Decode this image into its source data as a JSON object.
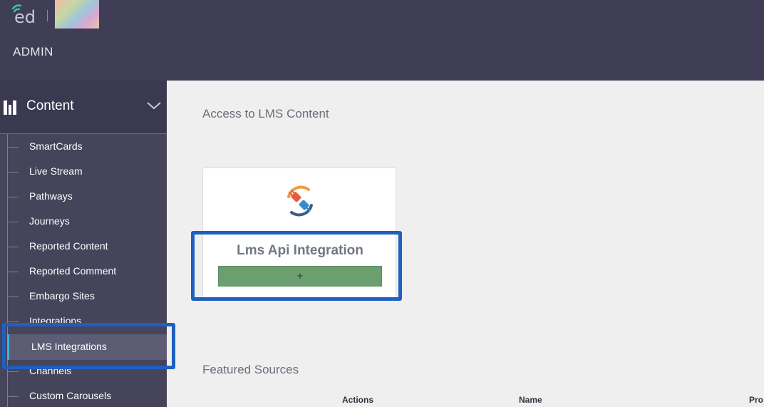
{
  "header": {
    "logo_icon": "ed-logo",
    "admin_label": "ADMIN"
  },
  "sidebar": {
    "section": {
      "title": "Content",
      "icon": "library-icon",
      "chevron": "chevron-down-icon"
    },
    "items": [
      {
        "label": "SmartCards"
      },
      {
        "label": "Live Stream"
      },
      {
        "label": "Pathways"
      },
      {
        "label": "Journeys"
      },
      {
        "label": "Reported Content"
      },
      {
        "label": "Reported Comment"
      },
      {
        "label": "Embargo Sites"
      },
      {
        "label": "Integrations"
      },
      {
        "label": "LMS Integrations",
        "active": true
      },
      {
        "label": "Channels"
      },
      {
        "label": "Custom Carousels"
      }
    ]
  },
  "main": {
    "title": "Access to LMS Content",
    "card": {
      "title": "Lms Api Integration",
      "button_label": "+",
      "icon": "plug-icon"
    },
    "featured_title": "Featured Sources",
    "table_headers": [
      "Actions",
      "Name",
      "Pro"
    ]
  },
  "colors": {
    "topbar": "#3f3e56",
    "sidebar": "#45445b",
    "active_accent": "#3ab7d6",
    "add_button": "#6c9f70",
    "highlight": "#1e5fc0"
  }
}
